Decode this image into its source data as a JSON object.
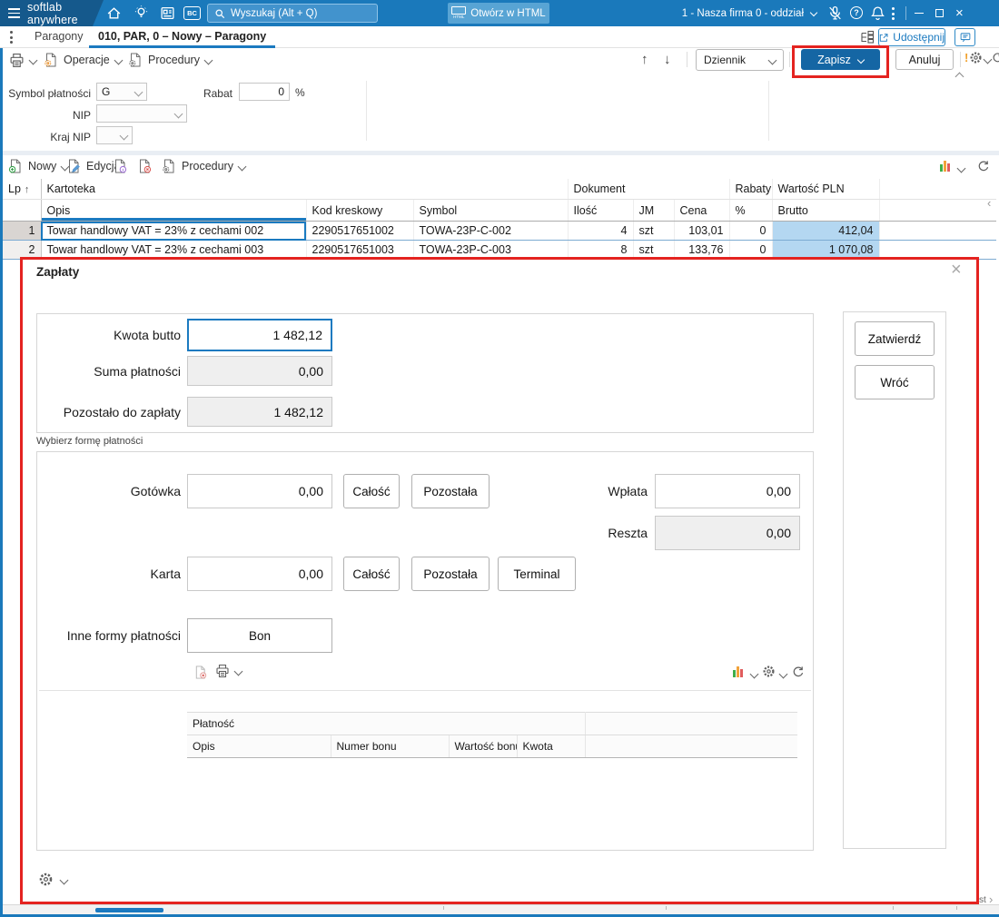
{
  "colors": {
    "accent_blue": "#1b7ac0",
    "topbar_blue": "#1a79bb",
    "brand_dark_blue": "#15598c",
    "save_button_blue": "#1566a4",
    "annotation_red": "#e42320",
    "row_highlight_blue": "#b4d7f1",
    "chart_icon_colors": [
      "#3fae49",
      "#f2a33c",
      "#e05c5c"
    ]
  },
  "topbar": {
    "brand": "softlab anywhere",
    "search_placeholder": "Wyszukaj (Alt + Q)",
    "open_html_label": "Otwórz w HTML",
    "html_badge": "HTML",
    "bc_badge": "BC",
    "company": "1 - Nasza firma 0 - oddział"
  },
  "tabbar": {
    "tabs": [
      {
        "label": "Paragony"
      },
      {
        "label": "010, PAR, 0 – Nowy – Paragony"
      }
    ],
    "share_label": "Udostępnij"
  },
  "toolbar": {
    "operations_label": "Operacje",
    "procedures_label": "Procedury",
    "journal_label": "Dziennik",
    "save_label": "Zapisz",
    "cancel_label": "Anuluj"
  },
  "form": {
    "payment_symbol_label": "Symbol płatności",
    "payment_symbol_value": "G",
    "nip_label": "NIP",
    "nip_value": "",
    "country_nip_label": "Kraj NIP",
    "country_nip_value": "",
    "discount_label": "Rabat",
    "discount_value": "0",
    "discount_suffix": "%"
  },
  "grid_toolbar": {
    "new_label": "Nowy",
    "edit_label": "Edycja",
    "procedures_label": "Procedury"
  },
  "items_table": {
    "lp_header": "Lp",
    "groups": {
      "kartoteka": "Kartoteka",
      "dokument": "Dokument",
      "rabaty": "Rabaty",
      "wartosc": "Wartość PLN"
    },
    "columns": {
      "opis": "Opis",
      "kod": "Kod kreskowy",
      "symbol": "Symbol",
      "ilosc": "Ilość",
      "jm": "JM",
      "cena": "Cena",
      "procent": "%",
      "brutto": "Brutto"
    },
    "rows": [
      {
        "lp": "1",
        "opis": "Towar handlowy VAT = 23% z cechami 002",
        "kod": "2290517651002",
        "symbol": "TOWA-23P-C-002",
        "ilosc": "4",
        "jm": "szt",
        "cena": "103,01",
        "rabat": "0",
        "brutto": "412,04"
      },
      {
        "lp": "2",
        "opis": "Towar handlowy VAT = 23% z cechami 003",
        "kod": "2290517651003",
        "symbol": "TOWA-23P-C-003",
        "ilosc": "8",
        "jm": "szt",
        "cena": "133,76",
        "rabat": "0",
        "brutto": "1 070,08"
      }
    ]
  },
  "dialog": {
    "title": "Zapłaty",
    "amounts": {
      "gross_label": "Kwota butto",
      "gross_value": "1 482,12",
      "payments_sum_label": "Suma płatności",
      "payments_sum_value": "0,00",
      "remaining_label": "Pozostało do zapłaty",
      "remaining_value": "1 482,12"
    },
    "payment_section_label": "Wybierz formę płatności",
    "cash_label": "Gotówka",
    "cash_value": "0,00",
    "full_button": "Całość",
    "remaining_button": "Pozostała",
    "terminal_button": "Terminal",
    "deposit_label": "Wpłata",
    "deposit_value": "0,00",
    "change_label": "Reszta",
    "change_value": "0,00",
    "card_label": "Karta",
    "card_value": "0,00",
    "other_label": "Inne formy płatności",
    "voucher_button": "Bon",
    "payments_table": {
      "group": "Płatność",
      "col_opis": "Opis",
      "col_numer": "Numer bonu",
      "col_wartosc": "Wartość bonu",
      "col_kwota": "Kwota"
    },
    "confirm_button": "Zatwierdź",
    "back_button": "Wróć"
  },
  "statusbar": {
    "clipped_text": "st"
  }
}
